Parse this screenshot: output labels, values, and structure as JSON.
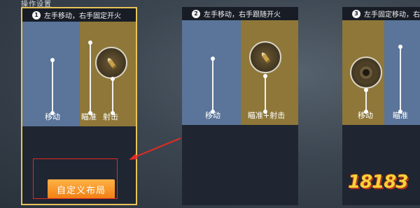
{
  "header": {
    "section_title": "操作设置"
  },
  "cards": [
    {
      "number": "1",
      "title": "左手移动，右手固定开火",
      "labels": {
        "move": "移动",
        "aim": "瞄准",
        "fire": "射击"
      },
      "custom_button": "自定义布局",
      "selected": true
    },
    {
      "number": "2",
      "title": "左手移动，右手跟随开火",
      "labels": {
        "move": "移动",
        "aim_fire": "瞄准+射击"
      }
    },
    {
      "number": "3",
      "title": "左手固定移动，右手",
      "labels": {
        "move": "移动",
        "aim": "瞄准"
      }
    }
  ],
  "watermark": {
    "text": "18183"
  },
  "icons": [
    "bullet-icon",
    "joystick-icon",
    "arrow-icon"
  ],
  "colors": {
    "accent_gold": "#e8c35a",
    "button_orange": "#f07e12",
    "highlight_red": "#e32b25",
    "panel_blue": "#5a749a",
    "panel_gold": "#8e7738"
  }
}
